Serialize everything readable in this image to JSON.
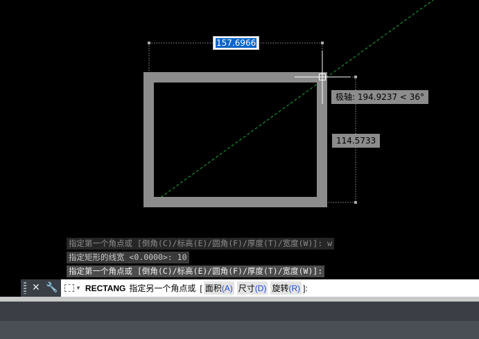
{
  "drawing": {
    "width_dim": "157.6966",
    "height_dim": "114.5733",
    "polar_tooltip": "极轴: 194.9237 < 36°"
  },
  "history": [
    "指定第一个角点或 [倒角(C)/标高(E)/圆角(F)/厚度(T)/宽度(W)]: w",
    "指定矩形的线宽 <0.0000>: 10",
    "指定第一个角点或 [倒角(C)/标高(E)/圆角(F)/厚度(T)/宽度(W)]:"
  ],
  "command": {
    "name": "RECTANG",
    "prompt": "指定另一个角点或",
    "bracket_open": "[",
    "bracket_close": "]:",
    "options": [
      {
        "label": "面积",
        "key": "(A)"
      },
      {
        "label": "尺寸",
        "key": "(D)"
      },
      {
        "label": "旋转",
        "key": "(R)"
      }
    ]
  },
  "icons": {
    "close": "close-icon",
    "customize": "wrench-icon",
    "recent": "command-dropdown-icon"
  },
  "colors": {
    "background": "#000000",
    "rectangle": "#8c8c8c",
    "polar_line": "#1fae3a",
    "selection": "#0a64c8"
  }
}
